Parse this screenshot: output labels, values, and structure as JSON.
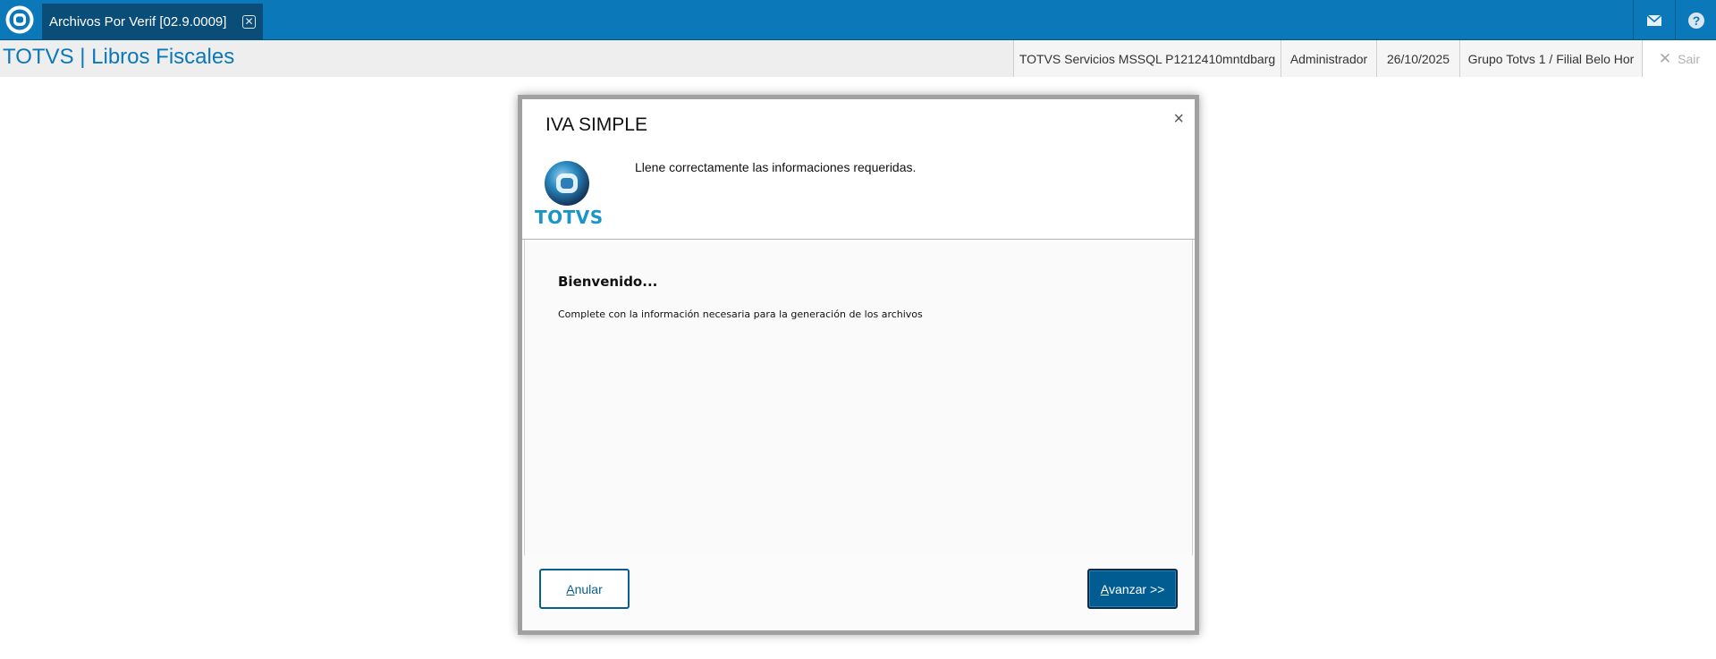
{
  "topbar": {
    "tab_label": "Archivos Por Verif [02.9.0009]",
    "tab_close": "✕",
    "colors": {
      "bar": "#0a78b9",
      "active_tab": "#0a4d78"
    }
  },
  "header": {
    "title": "TOTVS | Libros Fiscales",
    "environment": "TOTVS Servicios MSSQL P1212410mntdbarg",
    "user": "Administrador",
    "date": "26/10/2025",
    "branch": "Grupo Totvs 1 / Filial Belo Hor",
    "exit_label": "Sair",
    "exit_icon": "✕"
  },
  "dialog": {
    "title": "IVA SIMPLE",
    "close": "×",
    "logo_text": "TOTVS",
    "hint": "Llene correctamente las informaciones requeridas.",
    "welcome_title": "Bienvenido...",
    "welcome_text": "Complete con la información necesaria para la generación de los archivos",
    "cancel_label_first": "A",
    "cancel_label_rest": "nular",
    "next_label_first": "A",
    "next_label_rest": "vanzar >>"
  }
}
